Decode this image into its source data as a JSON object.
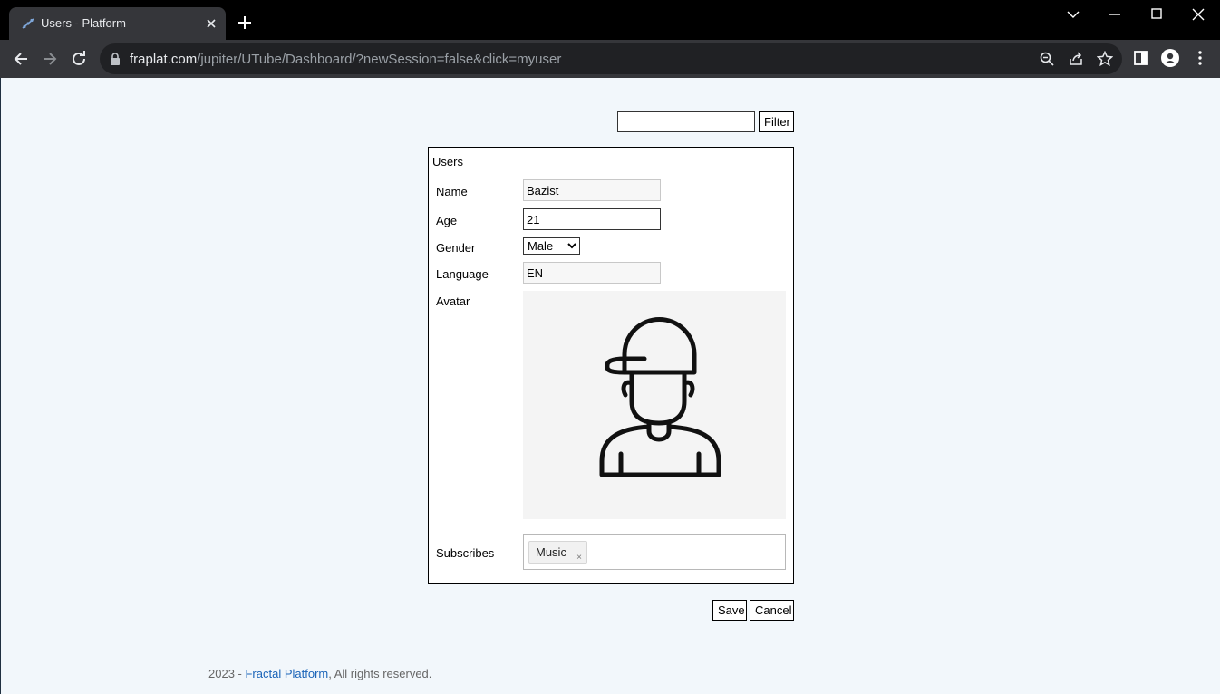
{
  "browser": {
    "tab_title": "Users - Platform",
    "url_domain": "fraplat.com",
    "url_path": "/jupiter/UTube/Dashboard/?newSession=false&click=myuser"
  },
  "filter": {
    "input_value": "",
    "button_label": "Filter"
  },
  "form": {
    "title": "Users",
    "fields": {
      "name": {
        "label": "Name",
        "value": "Bazist"
      },
      "age": {
        "label": "Age",
        "value": "21"
      },
      "gender": {
        "label": "Gender",
        "value": "Male"
      },
      "language": {
        "label": "Language",
        "value": "EN"
      },
      "avatar": {
        "label": "Avatar"
      },
      "subscribes": {
        "label": "Subscribes",
        "tags": [
          "Music"
        ],
        "tag_remove": "×"
      }
    }
  },
  "actions": {
    "save_label": "Save",
    "cancel_label": "Cancel"
  },
  "footer": {
    "year_prefix": "2023 - ",
    "link_text": "Fractal Platform",
    "suffix": ", All rights reserved."
  },
  "icons": {
    "favicon": "fractal-favicon-icon",
    "close": "close-icon",
    "new_tab": "plus-icon",
    "back": "arrow-left-icon",
    "forward": "arrow-right-icon",
    "reload": "reload-icon",
    "lock": "lock-icon",
    "zoom": "zoom-icon",
    "share": "share-icon",
    "bookmark": "star-icon",
    "side_panel": "side-panel-icon",
    "profile": "profile-icon",
    "menu": "kebab-menu-icon"
  },
  "colors": {
    "page_bg": "#f2f7fb",
    "link": "#1a64b8",
    "chrome_dark": "#35363a"
  }
}
